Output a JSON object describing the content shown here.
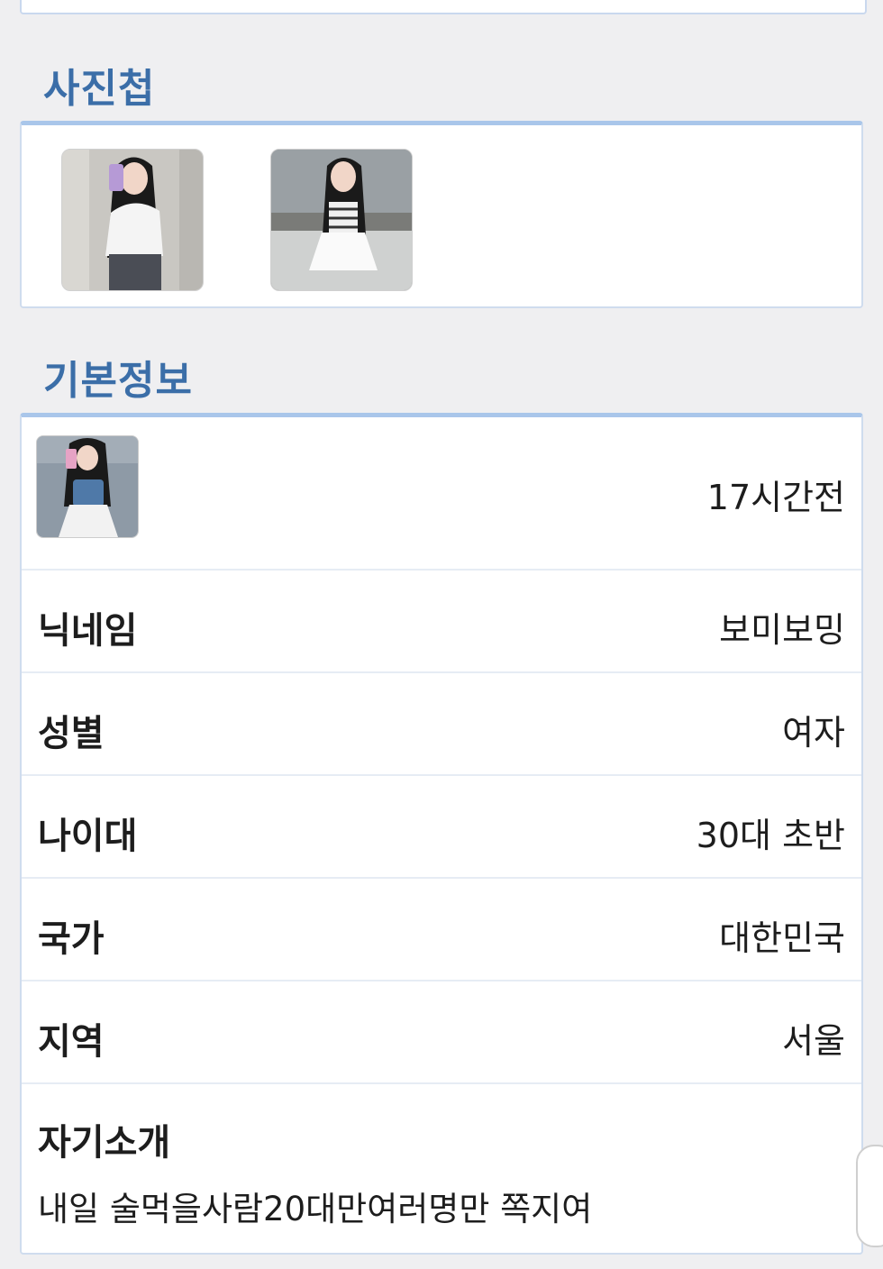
{
  "album": {
    "title": "사진첩",
    "photos": [
      {
        "name": "album-photo-1",
        "colors": {
          "bg": "#c9c7c2",
          "top": "#f4f4f4",
          "hair": "#1a1a1a",
          "jeans": "#4a4d55",
          "phone": "#b69ad6"
        }
      },
      {
        "name": "album-photo-2",
        "colors": {
          "bg": "#7a7b78",
          "top": "#f0f0f0",
          "hair": "#1a1a1a",
          "skirt": "#fafafa",
          "water": "#9aa0a4"
        }
      }
    ]
  },
  "basic_info": {
    "title": "기본정보",
    "last_seen": "17시간전",
    "avatar_colors": {
      "bg": "#8e9aa6",
      "top": "#4f79a8",
      "hair": "#1a1a1a",
      "skirt": "#f2f2f2",
      "phone": "#e6a3c5"
    },
    "rows": [
      {
        "label": "닉네임",
        "value": "보미보밍"
      },
      {
        "label": "성별",
        "value": "여자"
      },
      {
        "label": "나이대",
        "value": "30대 초반"
      },
      {
        "label": "국가",
        "value": "대한민국"
      },
      {
        "label": "지역",
        "value": "서울"
      }
    ],
    "intro": {
      "label": "자기소개",
      "text": "내일 술먹을사람20대만여러명만 쪽지여"
    }
  },
  "theme": {
    "accent": "#3b6ea8",
    "card_border": "#a9c6ea",
    "background": "#efeff1"
  }
}
